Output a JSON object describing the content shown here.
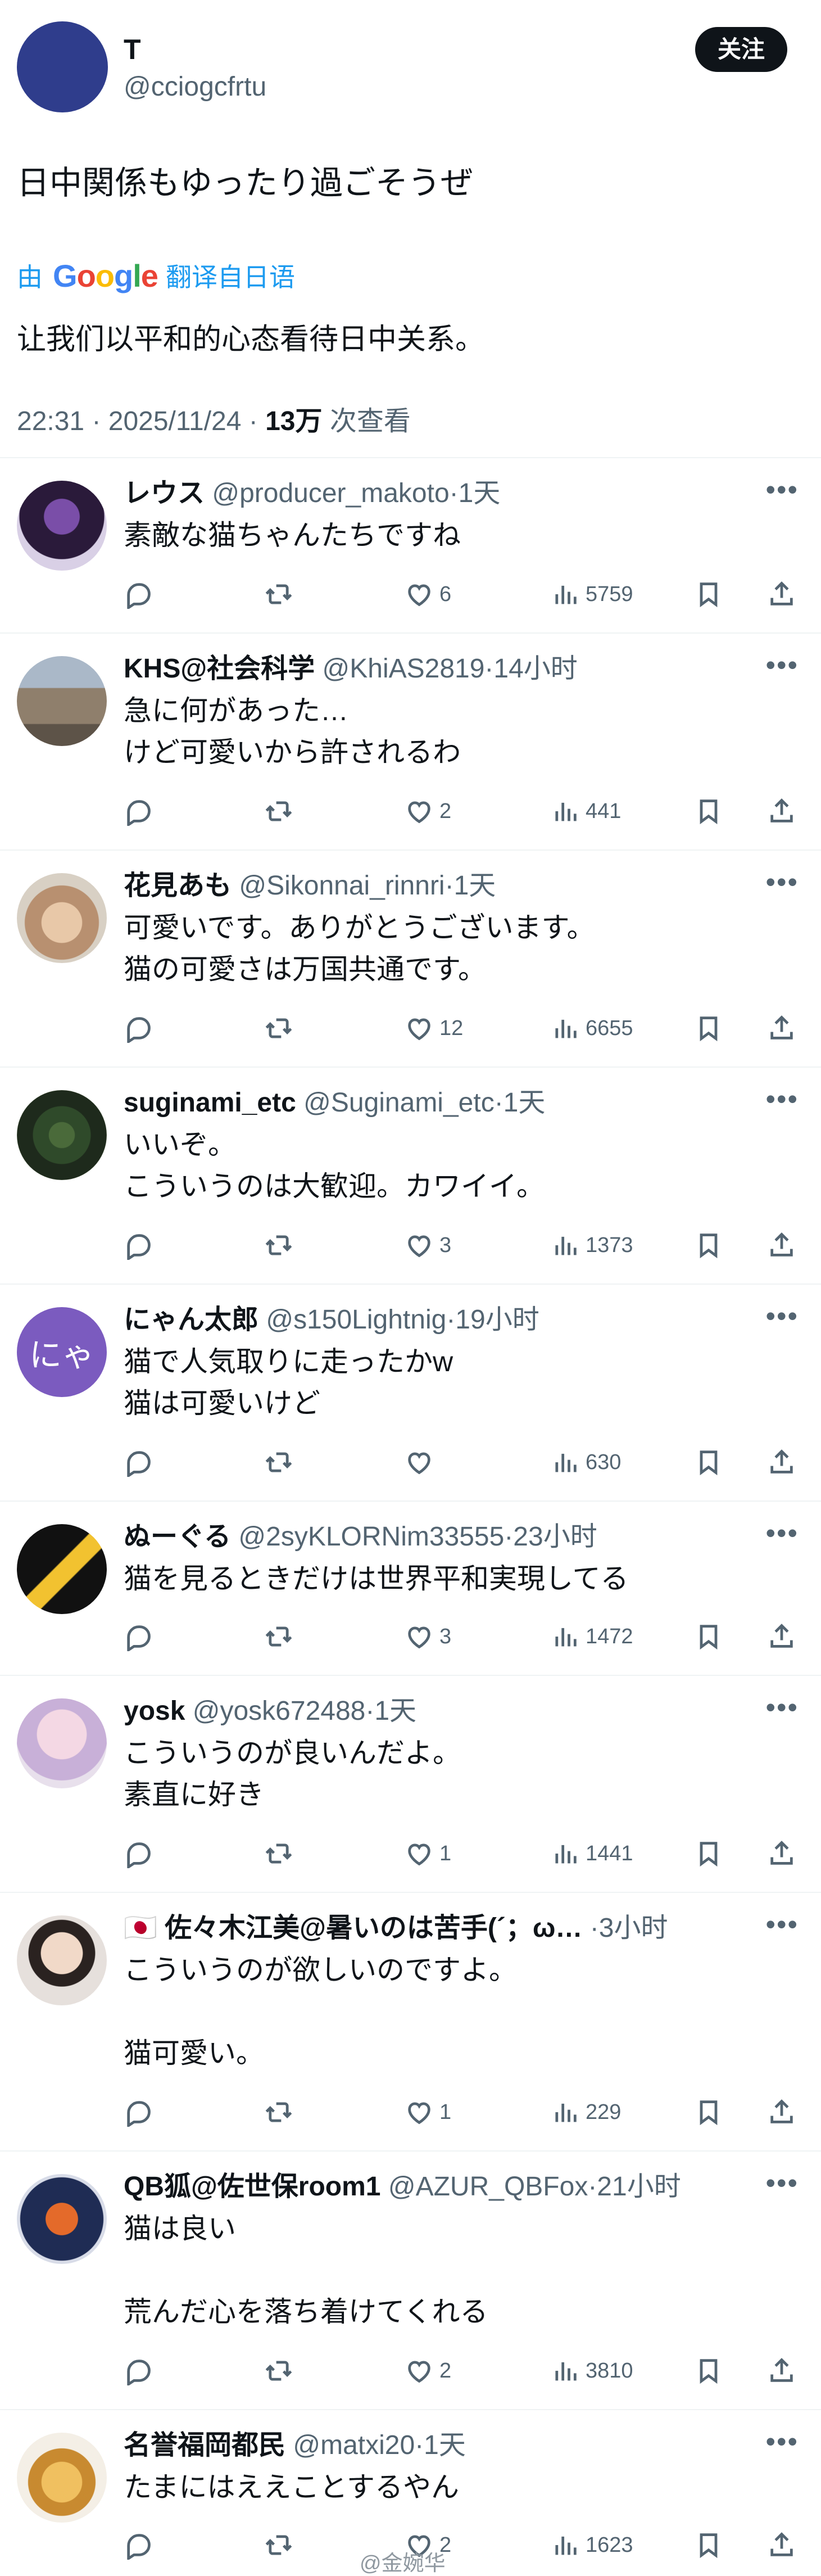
{
  "post": {
    "name": "T",
    "handle": "@cciogcfrtu",
    "follow_label": "关注",
    "text": "日中関係もゆったり過ごそうぜ",
    "translate_by": "由",
    "google": "Google",
    "translate_from": "翻译自日语",
    "translated_text": "让我们以平和的心态看待日中关系。",
    "time": "22:31 · 2025/11/24 · ",
    "views": "13万",
    "views_label": " 次查看"
  },
  "replies": [
    {
      "name": "レウス",
      "handle": "@producer_makoto",
      "time": "1天",
      "text": "素敵な猫ちゃんたちですね",
      "likes": "6",
      "views": "5759"
    },
    {
      "name": "KHS@社会科学",
      "handle": "@KhiAS2819",
      "time": "14小时",
      "text": "急に何があった…\nけど可愛いから許されるわ",
      "likes": "2",
      "views": "441"
    },
    {
      "name": "花見あも",
      "handle": "@Sikonnai_rinnri",
      "time": "1天",
      "text": "可愛いです。ありがとうございます。\n猫の可愛さは万国共通です。",
      "likes": "12",
      "views": "6655"
    },
    {
      "name": "suginami_etc",
      "handle": "@Suginami_etc",
      "time": "1天",
      "text": "いいぞ。\nこういうのは大歓迎。カワイイ。",
      "likes": "3",
      "views": "1373"
    },
    {
      "name": "にゃん太郎",
      "handle": "@s150Lightnig",
      "time": "19小时",
      "text": "猫で人気取りに走ったかw\n猫は可愛いけど",
      "likes": "",
      "views": "630",
      "avatar_text": "にゃ"
    },
    {
      "name": "ぬーぐる",
      "handle": "@2syKLORNim33555",
      "time": "23小时",
      "text": "猫を見るときだけは世界平和実現してる",
      "likes": "3",
      "views": "1472"
    },
    {
      "name": "yosk",
      "handle": "@yosk672488",
      "time": "1天",
      "text": "こういうのが良いんだよ。\n素直に好き",
      "likes": "1",
      "views": "1441"
    },
    {
      "name": "🇯🇵 佐々木江美@暑いのは苦手(´；ω…",
      "handle": "",
      "time": "3小时",
      "text": "こういうのが欲しいのですよ。\n\n猫可愛い。",
      "likes": "1",
      "views": "229"
    },
    {
      "name": "QB狐@佐世保room1",
      "handle": "@AZUR_QBFox",
      "time": "21小时",
      "text": "猫は良い\n\n荒んだ心を落ち着けてくれる",
      "likes": "2",
      "views": "3810"
    },
    {
      "name": "名誉福岡都民",
      "handle": "@matxi20",
      "time": "1天",
      "text": "たまにはええことするやん",
      "likes": "2",
      "views": "1623"
    }
  ],
  "watermark": "@金婉华",
  "colors": {
    "link": "#1d9bf0",
    "secondary": "#536471",
    "text": "#0f1419"
  }
}
